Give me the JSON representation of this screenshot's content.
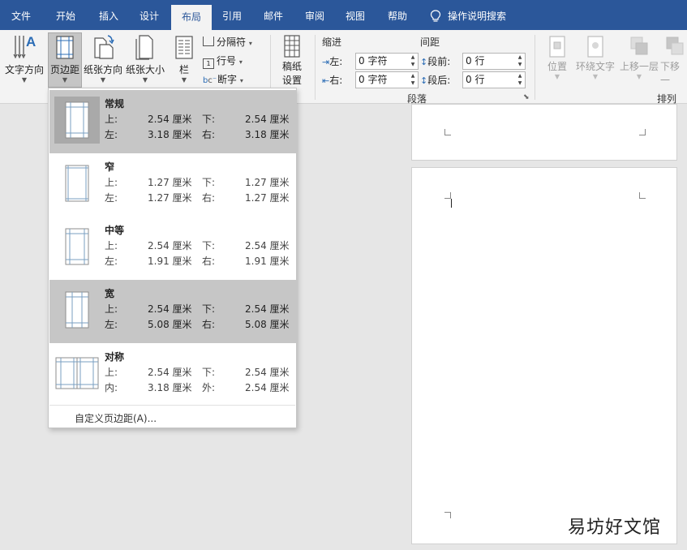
{
  "menu": {
    "tabs": [
      "文件",
      "开始",
      "插入",
      "设计",
      "布局",
      "引用",
      "邮件",
      "审阅",
      "视图",
      "帮助"
    ],
    "active_tab": "布局",
    "tell_me": "操作说明搜索"
  },
  "ribbon": {
    "text_direction": "文字方向",
    "margins": "页边距",
    "orientation": "纸张方向",
    "size": "纸张大小",
    "columns": "栏",
    "breaks": "分隔符",
    "line_numbers": "行号",
    "hyphenation": "断字",
    "draft_paper_1": "稿纸",
    "draft_paper_2": "设置",
    "indent": {
      "label": "缩进",
      "left_label": "左:",
      "left_value": "0 字符",
      "right_label": "右:",
      "right_value": "0 字符"
    },
    "spacing": {
      "label": "间距",
      "before_label": "段前:",
      "before_value": "0 行",
      "after_label": "段后:",
      "after_value": "0 行"
    },
    "paragraph_group": "段落",
    "arrange": {
      "position": "位置",
      "wrap_text": "环绕文字",
      "bring_forward": "上移一层",
      "send_backward": "下移一",
      "label": "排列"
    }
  },
  "margins_menu": {
    "options": [
      {
        "name": "常规",
        "l1": "上:",
        "v1": "2.54 厘米",
        "l2": "下:",
        "v2": "2.54 厘米",
        "l3": "左:",
        "v3": "3.18 厘米",
        "l4": "右:",
        "v4": "3.18 厘米"
      },
      {
        "name": "窄",
        "l1": "上:",
        "v1": "1.27 厘米",
        "l2": "下:",
        "v2": "1.27 厘米",
        "l3": "左:",
        "v3": "1.27 厘米",
        "l4": "右:",
        "v4": "1.27 厘米"
      },
      {
        "name": "中等",
        "l1": "上:",
        "v1": "2.54 厘米",
        "l2": "下:",
        "v2": "2.54 厘米",
        "l3": "左:",
        "v3": "1.91 厘米",
        "l4": "右:",
        "v4": "1.91 厘米"
      },
      {
        "name": "宽",
        "l1": "上:",
        "v1": "2.54 厘米",
        "l2": "下:",
        "v2": "2.54 厘米",
        "l3": "左:",
        "v3": "5.08 厘米",
        "l4": "右:",
        "v4": "5.08 厘米"
      },
      {
        "name": "对称",
        "l1": "上:",
        "v1": "2.54 厘米",
        "l2": "下:",
        "v2": "2.54 厘米",
        "l3": "内:",
        "v3": "3.18 厘米",
        "l4": "外:",
        "v4": "2.54 厘米"
      }
    ],
    "custom": "自定义页边距(A)..."
  },
  "watermark": "易坊好文馆",
  "colors": {
    "title_bar": "#2b579a",
    "ribbon_bg": "#f3f3f3",
    "selected_option": "#c6c6c6",
    "document_bg": "#e6e6e6"
  }
}
